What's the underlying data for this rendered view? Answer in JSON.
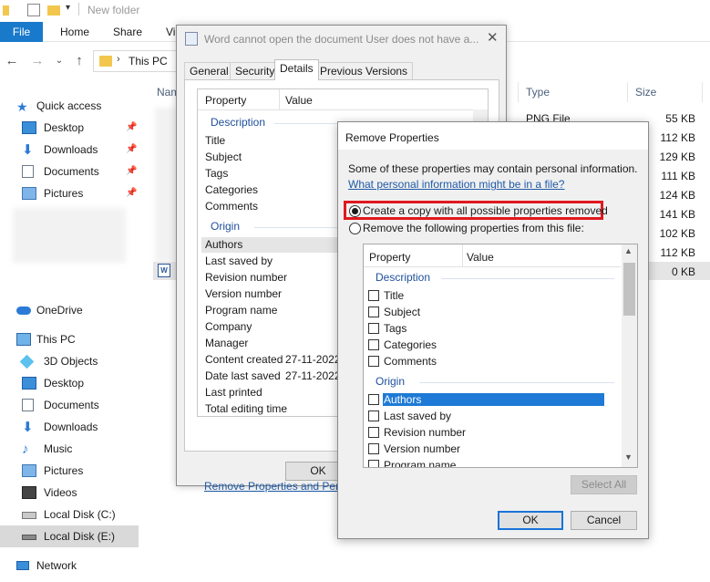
{
  "explorer": {
    "window_title": "New folder",
    "ribbon_tabs": [
      "File",
      "Home",
      "Share",
      "Vi"
    ],
    "breadcrumb": "This PC",
    "column_name": "Nam",
    "column_type": "Type",
    "column_size": "Size",
    "rows": [
      {
        "type": "PNG File",
        "size": "55 KB"
      },
      {
        "type": "",
        "size": "112 KB"
      },
      {
        "type": "",
        "size": "129 KB"
      },
      {
        "type": "",
        "size": "111 KB"
      },
      {
        "type": "",
        "size": "124 KB"
      },
      {
        "type": "",
        "size": "141 KB"
      },
      {
        "type": "",
        "size": "102 KB"
      },
      {
        "type": "",
        "size": "112 KB"
      },
      {
        "type": "",
        "size": "0 KB"
      }
    ],
    "nav": {
      "quick_access": "Quick access",
      "qa_items": [
        "Desktop",
        "Downloads",
        "Documents",
        "Pictures"
      ],
      "onedrive": "OneDrive",
      "this_pc": "This PC",
      "pc_items": [
        "3D Objects",
        "Desktop",
        "Documents",
        "Downloads",
        "Music",
        "Pictures",
        "Videos",
        "Local Disk (C:)",
        "Local Disk (E:)"
      ],
      "network": "Network"
    }
  },
  "properties_dialog": {
    "title": "Word cannot open the document User does not have a...",
    "tabs": [
      "General",
      "Security",
      "Details",
      "Previous Versions"
    ],
    "active_tab": "Details",
    "header_property": "Property",
    "header_value": "Value",
    "group_description": "Description",
    "description_items": [
      "Title",
      "Subject",
      "Tags",
      "Categories",
      "Comments"
    ],
    "group_origin": "Origin",
    "origin_items": [
      "Authors",
      "Last saved by",
      "Revision number",
      "Version number",
      "Program name",
      "Company",
      "Manager",
      "Content created",
      "Date last saved",
      "Last printed",
      "Total editing time"
    ],
    "content_created_value": "27-11-2022",
    "date_last_saved_value": "27-11-2022",
    "remove_link": "Remove Properties and Personal",
    "ok_label": "OK"
  },
  "remove_dialog": {
    "title": "Remove Properties",
    "info": "Some of these properties may contain personal information.",
    "link": "What personal information might be in a file?",
    "option_copy": "Create a copy with all possible properties removed",
    "option_remove": "Remove the following properties from this file:",
    "selected_option": "copy",
    "header_property": "Property",
    "header_value": "Value",
    "group_description": "Description",
    "description_items": [
      "Title",
      "Subject",
      "Tags",
      "Categories",
      "Comments"
    ],
    "group_origin": "Origin",
    "origin_items": [
      "Authors",
      "Last saved by",
      "Revision number",
      "Version number",
      "Program name"
    ],
    "select_all_label": "Select All",
    "ok_label": "OK",
    "cancel_label": "Cancel"
  },
  "colors": {
    "accent": "#1979ca",
    "highlight": "#e0181f",
    "selection": "#1e7ad6"
  }
}
